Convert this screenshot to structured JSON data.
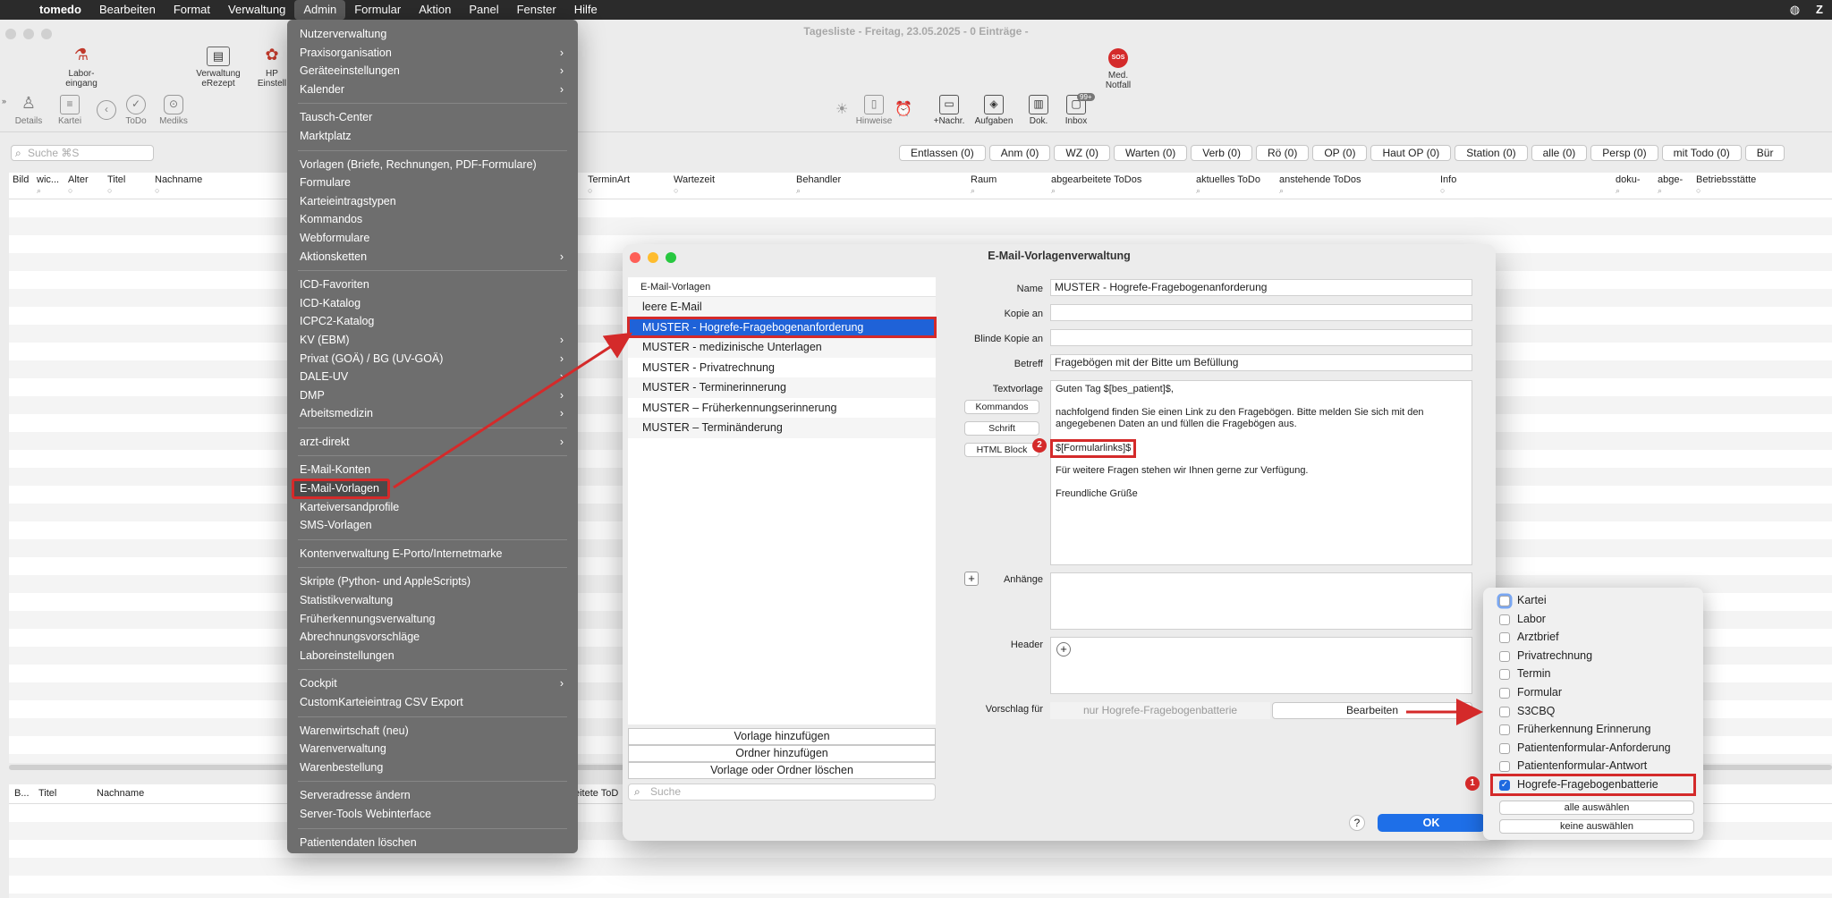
{
  "menubar": {
    "apple": "",
    "items": [
      "tomedo",
      "Bearbeiten",
      "Format",
      "Verwaltung",
      "Admin",
      "Formular",
      "Aktion",
      "Panel",
      "Fenster",
      "Hilfe"
    ],
    "active": "Admin",
    "right_user": "Z"
  },
  "window": {
    "title": "Tagesliste - Freitag, 23.05.2025 - 0 Einträge -"
  },
  "toolbar1": {
    "labor": "Labor-\neingang",
    "erezept": "Verwaltung\neRezept",
    "hp": "HP\nEinstell",
    "notfall": "Med.\nNotfall",
    "sos": "SOS"
  },
  "toolbar2": {
    "details": "Details",
    "kartei": "Kartei",
    "todo": "ToDo",
    "mediks": "Mediks",
    "hinweise": "Hinweise",
    "nachr": "+Nachr.",
    "aufgaben": "Aufgaben",
    "dok": "Dok.",
    "inbox": "Inbox",
    "inbox_badge": "99+"
  },
  "search": {
    "placeholder": "Suche ⌘S"
  },
  "filters": [
    "Entlassen (0)",
    "Anm (0)",
    "WZ (0)",
    "Warten (0)",
    "Verb (0)",
    "Rö (0)",
    "OP (0)",
    "Haut OP (0)",
    "Station (0)",
    "alle (0)",
    "Persp (0)",
    "mit Todo (0)",
    "Bür"
  ],
  "columns": [
    "Bild",
    "wic...",
    "Alter",
    "Titel",
    "Nachname",
    "TerminArt",
    "Wartezeit",
    "Behandler",
    "Raum",
    "abgearbeitete ToDos",
    "aktuelles ToDo",
    "anstehende ToDos",
    "Info",
    "doku-",
    "abge-",
    "Betriebsstätte"
  ],
  "columns2": [
    "B...",
    "Titel",
    "Nachname",
    "eitete ToD"
  ],
  "admin_menu": [
    {
      "label": "Nutzerverwaltung",
      "sub": false
    },
    {
      "label": "Praxisorganisation",
      "sub": true
    },
    {
      "label": "Geräteeinstellungen",
      "sub": true
    },
    {
      "label": "Kalender",
      "sub": true
    },
    {
      "sep": true
    },
    {
      "label": "Tausch-Center",
      "sub": false
    },
    {
      "label": "Marktplatz",
      "sub": false
    },
    {
      "sep": true
    },
    {
      "label": "Vorlagen (Briefe, Rechnungen, PDF-Formulare)",
      "sub": false
    },
    {
      "label": "Formulare",
      "sub": false
    },
    {
      "label": "Karteieintragstypen",
      "sub": false
    },
    {
      "label": "Kommandos",
      "sub": false
    },
    {
      "label": "Webformulare",
      "sub": false
    },
    {
      "label": "Aktionsketten",
      "sub": true
    },
    {
      "sep": true
    },
    {
      "label": "ICD-Favoriten",
      "sub": false
    },
    {
      "label": "ICD-Katalog",
      "sub": false
    },
    {
      "label": "ICPC2-Katalog",
      "sub": false
    },
    {
      "label": "KV (EBM)",
      "sub": true
    },
    {
      "label": "Privat (GOÄ) / BG (UV-GOÄ)",
      "sub": true
    },
    {
      "label": "DALE-UV",
      "sub": true
    },
    {
      "label": "DMP",
      "sub": true
    },
    {
      "label": "Arbeitsmedizin",
      "sub": true
    },
    {
      "sep": true
    },
    {
      "label": "arzt-direkt",
      "sub": true
    },
    {
      "sep": true
    },
    {
      "label": "E-Mail-Konten",
      "sub": false
    },
    {
      "label": "E-Mail-Vorlagen",
      "sub": false,
      "highlight": true
    },
    {
      "label": "Karteiversandprofile",
      "sub": false
    },
    {
      "label": "SMS-Vorlagen",
      "sub": false
    },
    {
      "sep": true
    },
    {
      "label": "Kontenverwaltung E-Porto/Internetmarke",
      "sub": false
    },
    {
      "sep": true
    },
    {
      "label": "Skripte (Python- und AppleScripts)",
      "sub": false
    },
    {
      "label": "Statistikverwaltung",
      "sub": false
    },
    {
      "label": "Früherkennungsverwaltung",
      "sub": false
    },
    {
      "label": "Abrechnungsvorschläge",
      "sub": false
    },
    {
      "label": "Laboreinstellungen",
      "sub": false
    },
    {
      "sep": true
    },
    {
      "label": "Cockpit",
      "sub": true
    },
    {
      "label": "CustomKarteieintrag CSV Export",
      "sub": false
    },
    {
      "sep": true
    },
    {
      "label": "Warenwirtschaft (neu)",
      "sub": false
    },
    {
      "label": "Warenverwaltung",
      "sub": false
    },
    {
      "label": "Warenbestellung",
      "sub": false
    },
    {
      "sep": true
    },
    {
      "label": "Serveradresse ändern",
      "sub": false
    },
    {
      "label": "Server-Tools Webinterface",
      "sub": false
    },
    {
      "sep": true
    },
    {
      "label": "Patientendaten löschen",
      "sub": false
    }
  ],
  "dialog": {
    "title": "E-Mail-Vorlagenverwaltung",
    "list_header": "E-Mail-Vorlagen",
    "templates": [
      "leere E-Mail",
      "MUSTER - Hogrefe-Fragebogenanforderung",
      "MUSTER - medizinische Unterlagen",
      "MUSTER - Privatrechnung",
      "MUSTER - Terminerinnerung",
      "MUSTER – Früherkennungserinnerung",
      "MUSTER – Terminänderung"
    ],
    "selected_index": 1,
    "add_template": "Vorlage hinzufügen",
    "add_folder": "Ordner hinzufügen",
    "delete": "Vorlage oder Ordner löschen",
    "search_placeholder": "Suche",
    "labels": {
      "name": "Name",
      "cc": "Kopie an",
      "bcc": "Blinde Kopie an",
      "subject": "Betreff",
      "textvorlage": "Textvorlage",
      "attachments": "Anhänge",
      "header": "Header",
      "suggestion": "Vorschlag für"
    },
    "name_value": "MUSTER - Hogrefe-Fragebogenanforderung",
    "cc_value": "",
    "bcc_value": "",
    "subject_value": "Fragebögen mit der Bitte um Befüllung",
    "side_buttons": [
      "Kommandos",
      "Schrift",
      "HTML Block"
    ],
    "body": {
      "greeting": "Guten Tag $[bes_patient]$,",
      "para1": "nachfolgend finden Sie einen Link zu den Fragebögen. Bitte melden Sie sich mit den angegebenen Daten an und füllen die Fragebögen aus.",
      "formlinks": "$[Formularlinks]$",
      "para2": "Für weitere Fragen stehen wir Ihnen gerne zur Verfügung.",
      "closing": "Freundliche Grüße"
    },
    "suggestion_value": "nur Hogrefe-Fragebogenbatterie",
    "edit_button": "Bearbeiten",
    "ok": "OK",
    "help": "?"
  },
  "popover": {
    "items": [
      {
        "label": "Kartei",
        "checked": false,
        "focus": true
      },
      {
        "label": "Labor",
        "checked": false
      },
      {
        "label": "Arztbrief",
        "checked": false
      },
      {
        "label": "Privatrechnung",
        "checked": false
      },
      {
        "label": "Termin",
        "checked": false
      },
      {
        "label": "Formular",
        "checked": false
      },
      {
        "label": "S3CBQ",
        "checked": false
      },
      {
        "label": "Früherkennung Erinnerung",
        "checked": false
      },
      {
        "label": "Patientenformular-Anforderung",
        "checked": false
      },
      {
        "label": "Patientenformular-Antwort",
        "checked": false
      },
      {
        "label": "Hogrefe-Fragebogenbatterie",
        "checked": true,
        "highlight": true
      }
    ],
    "select_all": "alle auswählen",
    "select_none": "keine auswählen"
  },
  "annotations": {
    "badge1": "1",
    "badge2": "2",
    "accent": "#d42a2a"
  }
}
